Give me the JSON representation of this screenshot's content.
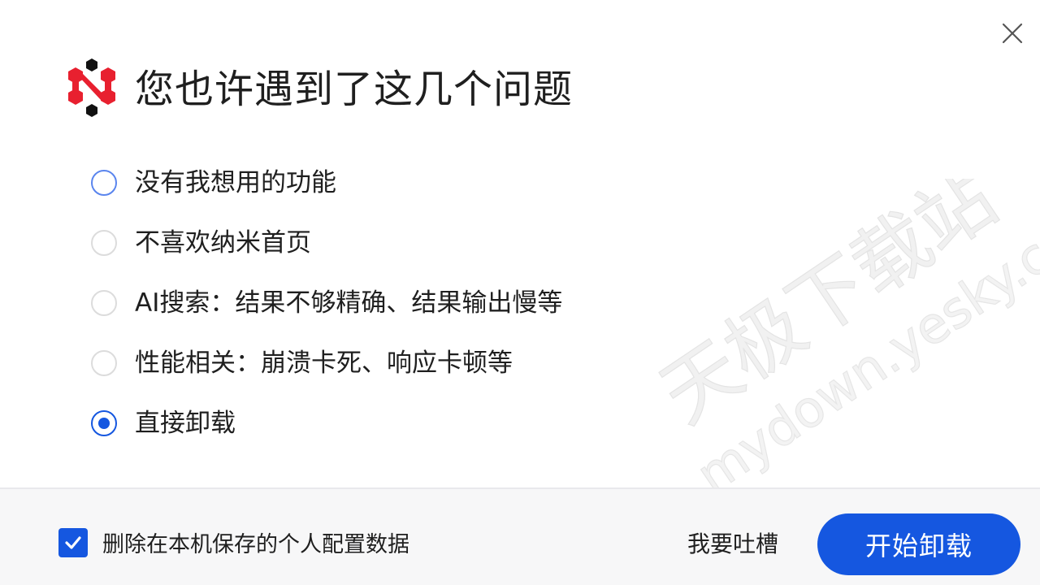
{
  "dialog": {
    "title": "您也许遇到了这几个问题",
    "close_icon": "close-icon",
    "logo_icon": "nami-logo-icon"
  },
  "options": [
    {
      "label": "没有我想用的功能",
      "state": "hover"
    },
    {
      "label": "不喜欢纳米首页",
      "state": "unchecked"
    },
    {
      "label": "AI搜索：结果不够精确、结果输出慢等",
      "state": "unchecked"
    },
    {
      "label": "性能相关：崩溃卡死、响应卡顿等",
      "state": "unchecked"
    },
    {
      "label": "直接卸载",
      "state": "checked"
    }
  ],
  "footer": {
    "checkbox_label": "删除在本机保存的个人配置数据",
    "checkbox_checked": true,
    "feedback_label": "我要吐槽",
    "primary_button_label": "开始卸载"
  },
  "watermark": {
    "line1": "天极下载站",
    "line2": "mydown.yesky.com"
  },
  "colors": {
    "accent": "#1557e0",
    "logo_red": "#e8202f",
    "logo_black": "#111111",
    "text": "#1f1f1f",
    "footer_bg": "#f7f7f8"
  }
}
